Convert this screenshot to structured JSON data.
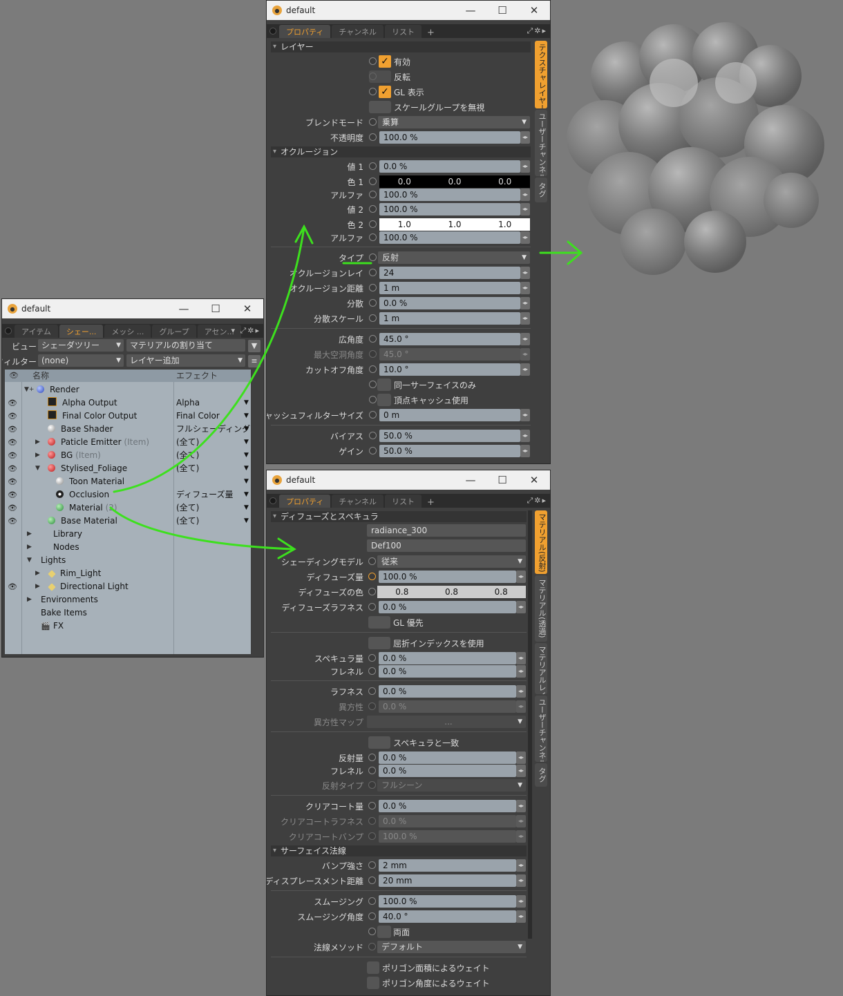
{
  "colors": {
    "accent": "#f0a030",
    "panel": "#3f3f3f",
    "tree_bg": "#a7b1b9",
    "arrow": "#3de01e"
  },
  "window_title": "default",
  "window_controls": {
    "minimize": "—",
    "maximize": "☐",
    "close": "✕"
  },
  "top_panel": {
    "tabs": [
      "プロパティ",
      "チャンネル",
      "リスト"
    ],
    "plus": "+",
    "side_tabs": [
      "テクスチャレイヤー",
      "ユーザーチャンネル",
      "タグ"
    ],
    "sections": {
      "layer": "レイヤー",
      "occlusion": "オクルージョン"
    },
    "layer": {
      "enable": "有効",
      "invert": "反転",
      "gl_display": "GL 表示",
      "ignore_scale_group": "スケールグループを無視",
      "blend_mode_label": "ブレンドモード",
      "blend_mode_value": "乗算",
      "opacity_label": "不透明度",
      "opacity_value": "100.0 %"
    },
    "occlusion": {
      "value1_label": "値 1",
      "value1": "0.0 %",
      "color1_label": "色 1",
      "color1": [
        "0.0",
        "0.0",
        "0.0"
      ],
      "alpha1_label": "アルファ",
      "alpha1": "100.0 %",
      "value2_label": "値 2",
      "value2": "100.0 %",
      "color2_label": "色 2",
      "color2": [
        "1.0",
        "1.0",
        "1.0"
      ],
      "alpha2_label": "アルファ",
      "alpha2": "100.0 %",
      "type_label": "タイプ",
      "type_value": "反射",
      "rays_label": "オクルージョンレイ",
      "rays_value": "24",
      "distance_label": "オクルージョン距離",
      "distance_value": "1 m",
      "variance_label": "分散",
      "variance_value": "0.0 %",
      "variance_scale_label": "分散スケール",
      "variance_scale_value": "1 m",
      "spread_label": "広角度",
      "spread_value": "45.0 °",
      "max_cavity_label": "最大空洞角度",
      "max_cavity_value": "45.0 °",
      "cutoff_label": "カットオフ角度",
      "cutoff_value": "10.0 °",
      "same_surface": "同一サーフェイスのみ",
      "vertex_cache": "頂点キャッシュ使用",
      "cache_filter_label": "キャッシュフィルターサイズ",
      "cache_filter_value": "0 m",
      "bias_label": "バイアス",
      "bias_value": "50.0 %",
      "gain_label": "ゲイン",
      "gain_value": "50.0 %"
    }
  },
  "bottom_panel": {
    "tabs": [
      "プロパティ",
      "チャンネル",
      "リスト"
    ],
    "plus": "+",
    "side_tabs": [
      "マテリアル(反射)",
      "マテリアル(透過)",
      "マテリアルレイ",
      "ユーザーチャンネル",
      "タグ"
    ],
    "sections": {
      "diffuse_spec": "ディフューズとスペキュラ",
      "surface_normal": "サーフェイス法線"
    },
    "fields": {
      "name1": "radiance_300",
      "name2": "Def100",
      "shading_model_label": "シェーディングモデル",
      "shading_model_value": "従来",
      "diffuse_amount_label": "ディフューズ量",
      "diffuse_amount_value": "100.0 %",
      "diffuse_color_label": "ディフューズの色",
      "diffuse_color": [
        "0.8",
        "0.8",
        "0.8"
      ],
      "diffuse_rough_label": "ディフューズラフネス",
      "diffuse_rough_value": "0.0 %",
      "gl_priority": "GL 優先",
      "use_refr_index": "屈折インデックスを使用",
      "spec_amount_label": "スペキュラ量",
      "spec_amount_value": "0.0 %",
      "fresnel_label": "フレネル",
      "fresnel_value": "0.0 %",
      "roughness_label": "ラフネス",
      "roughness_value": "0.0 %",
      "anisotropy_label": "異方性",
      "anisotropy_value": "0.0 %",
      "aniso_map_label": "異方性マップ",
      "aniso_map_value": "...",
      "match_spec": "スペキュラと一致",
      "refl_amount_label": "反射量",
      "refl_amount_value": "0.0 %",
      "refl_fresnel_label": "フレネル",
      "refl_fresnel_value": "0.0 %",
      "refl_type_label": "反射タイプ",
      "refl_type_value": "フルシーン",
      "clearcoat_label": "クリアコート量",
      "clearcoat_value": "0.0 %",
      "clearcoat_rough_label": "クリアコートラフネス",
      "clearcoat_rough_value": "0.0 %",
      "clearcoat_bump_label": "クリアコートバンプ",
      "clearcoat_bump_value": "100.0 %",
      "bump_label": "バンプ強さ",
      "bump_value": "2 mm",
      "disp_label": "ディスプレースメント距離",
      "disp_value": "20 mm",
      "smoothing_label": "スムージング",
      "smoothing_value": "100.0 %",
      "smooth_angle_label": "スムージング角度",
      "smooth_angle_value": "40.0 °",
      "double_sided": "両面",
      "normal_method_label": "法線メソッド",
      "normal_method_value": "デフォルト",
      "weight_area": "ポリゴン面積によるウェイト",
      "weight_angle": "ポリゴン角度によるウェイト"
    }
  },
  "shader_tree": {
    "tabs": [
      "アイテム",
      "シェー...",
      "メッシ ...",
      "グループ",
      "アセン..."
    ],
    "view_label": "ビュー",
    "view_value": "シェーダツリー",
    "assign_value": "マテリアルの割り当て",
    "filter_label": "フィルター",
    "filter_value": "(none)",
    "add_layer_value": "レイヤー追加",
    "col_name": "名称",
    "col_effect": "エフェクト",
    "rows": [
      {
        "name": "Render",
        "suffix": "",
        "effect": ""
      },
      {
        "name": "Alpha Output",
        "suffix": "",
        "effect": "Alpha"
      },
      {
        "name": "Final Color Output",
        "suffix": "",
        "effect": "Final Color"
      },
      {
        "name": "Base Shader",
        "suffix": "",
        "effect": "フルシェーディング"
      },
      {
        "name": "Paticle Emitter",
        "suffix": "(Item)",
        "effect": "(全て)"
      },
      {
        "name": "BG",
        "suffix": "(Item)",
        "effect": "(全て)"
      },
      {
        "name": "Stylised_Foliage",
        "suffix": "",
        "effect": "(全て)"
      },
      {
        "name": "Toon Material",
        "suffix": "",
        "effect": ""
      },
      {
        "name": "Occlusion",
        "suffix": "",
        "effect": "ディフューズ量"
      },
      {
        "name": "Material",
        "suffix": "(2)",
        "effect": "(全て)"
      },
      {
        "name": "Base Material",
        "suffix": "",
        "effect": "(全て)"
      },
      {
        "name": "Library",
        "suffix": "",
        "effect": ""
      },
      {
        "name": "Nodes",
        "suffix": "",
        "effect": ""
      },
      {
        "name": "Lights",
        "suffix": "",
        "effect": ""
      },
      {
        "name": "Rim_Light",
        "suffix": "",
        "effect": ""
      },
      {
        "name": "Directional Light",
        "suffix": "",
        "effect": ""
      },
      {
        "name": "Environments",
        "suffix": "",
        "effect": ""
      },
      {
        "name": "Bake Items",
        "suffix": "",
        "effect": ""
      },
      {
        "name": "FX",
        "suffix": "",
        "effect": ""
      }
    ]
  }
}
